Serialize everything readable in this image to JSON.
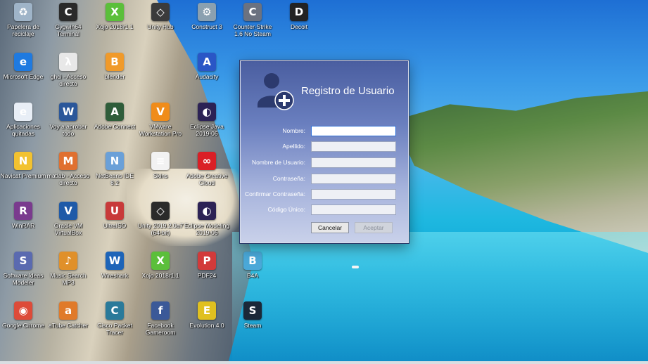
{
  "desktop": {
    "icons": [
      {
        "label": "Papelera de reciclaje",
        "icon": "recycle-bin-icon",
        "color": "#9fb4c8",
        "glyph": "♻"
      },
      {
        "label": "Cygwin64 Terminal",
        "icon": "terminal-icon",
        "color": "#2a2a2a",
        "glyph": "C"
      },
      {
        "label": "Xojo 2018r1.1",
        "icon": "xojo-icon",
        "color": "#5bbf3a",
        "glyph": "X"
      },
      {
        "label": "Unity Hub",
        "icon": "unity-icon",
        "color": "#3b3b3b",
        "glyph": "◇"
      },
      {
        "label": "Construct 3",
        "icon": "construct-icon",
        "color": "#8aa0b0",
        "glyph": "⚙"
      },
      {
        "label": "Counter-Strike 1.6 No Steam",
        "icon": "counter-strike-icon",
        "color": "#6b7280",
        "glyph": "C"
      },
      {
        "label": "Decoit",
        "icon": "decoit-icon",
        "color": "#222222",
        "glyph": "D"
      },
      {
        "label": "Microsoft Edge",
        "icon": "edge-icon",
        "color": "#1f7ae0",
        "glyph": "e"
      },
      {
        "label": "ghci - Acceso directo",
        "icon": "ghci-icon",
        "color": "#e8e8e8",
        "glyph": "λ"
      },
      {
        "label": "blender",
        "icon": "blender-icon",
        "color": "#f09a2a",
        "glyph": "B"
      },
      {
        "label": "Audacity",
        "icon": "audacity-icon",
        "color": "#2a56c6",
        "glyph": "A"
      },
      {
        "label": "Aplicaciones quitadas",
        "icon": "html-document-icon",
        "color": "#e8eef6",
        "glyph": "e"
      },
      {
        "label": "Voy a aprobar todo",
        "icon": "word-icon",
        "color": "#2b579a",
        "glyph": "W"
      },
      {
        "label": "Adobe Connect",
        "icon": "adobe-connect-icon",
        "color": "#2f5d3a",
        "glyph": "A"
      },
      {
        "label": "VMware Workstation Pro",
        "icon": "vmware-icon",
        "color": "#f08c1a",
        "glyph": "V"
      },
      {
        "label": "Eclipse Java 2019-06",
        "icon": "eclipse-icon",
        "color": "#2c2255",
        "glyph": "◐"
      },
      {
        "label": "Navicat Premium",
        "icon": "navicat-icon",
        "color": "#f2c230",
        "glyph": "N"
      },
      {
        "label": "matlab - Acceso directo",
        "icon": "matlab-icon",
        "color": "#e07030",
        "glyph": "M"
      },
      {
        "label": "NetBeans IDE 8.2",
        "icon": "netbeans-icon",
        "color": "#6aa0d8",
        "glyph": "N"
      },
      {
        "label": "Skins",
        "icon": "text-file-icon",
        "color": "#f2f2f2",
        "glyph": "≡"
      },
      {
        "label": "Adobe Creative Cloud",
        "icon": "creative-cloud-icon",
        "color": "#da1f26",
        "glyph": "∞"
      },
      {
        "label": "WinRAR",
        "icon": "winrar-icon",
        "color": "#7a3a8e",
        "glyph": "R"
      },
      {
        "label": "Oracle VM VirtualBox",
        "icon": "virtualbox-icon",
        "color": "#1e5aa8",
        "glyph": "V"
      },
      {
        "label": "UltraISO",
        "icon": "ultraiso-icon",
        "color": "#c83a3a",
        "glyph": "U"
      },
      {
        "label": "Unity 2019.2.0a7 (64-bit)",
        "icon": "unity-icon",
        "color": "#2a2a2a",
        "glyph": "◇"
      },
      {
        "label": "Eclipse Modeling 2019-06",
        "icon": "eclipse-modeling-icon",
        "color": "#2c2255",
        "glyph": "◐"
      },
      {
        "label": "Software Ideas Modeler",
        "icon": "modeler-icon",
        "color": "#5a6ab0",
        "glyph": "S"
      },
      {
        "label": "Music Search MP3",
        "icon": "music-search-icon",
        "color": "#e0902a",
        "glyph": "♪"
      },
      {
        "label": "Wireshark",
        "icon": "wireshark-icon",
        "color": "#1d64b8",
        "glyph": "W"
      },
      {
        "label": "Xojo 2018r1.1",
        "icon": "xojo-icon",
        "color": "#5bbf3a",
        "glyph": "X"
      },
      {
        "label": "PDF24",
        "icon": "pdf24-icon",
        "color": "#d23a3a",
        "glyph": "P"
      },
      {
        "label": "B4A",
        "icon": "b4a-icon",
        "color": "#4aa8d8",
        "glyph": "B"
      },
      {
        "label": "Google Chrome",
        "icon": "chrome-icon",
        "color": "#dd4b39",
        "glyph": "◉"
      },
      {
        "label": "aTube Catcher",
        "icon": "atube-catcher-icon",
        "color": "#e07a2a",
        "glyph": "a"
      },
      {
        "label": "Cisco Packet Tracer",
        "icon": "packet-tracer-icon",
        "color": "#2a7a9a",
        "glyph": "C"
      },
      {
        "label": "Facebook Gameroom",
        "icon": "gameroom-icon",
        "color": "#3b5998",
        "glyph": "f"
      },
      {
        "label": "Evolution 4.0",
        "icon": "evolution-icon",
        "color": "#e0c020",
        "glyph": "E"
      },
      {
        "label": "Steam",
        "icon": "steam-icon",
        "color": "#1b2838",
        "glyph": "S"
      }
    ]
  },
  "dialog": {
    "title": "Registro de Usuario",
    "fields": [
      {
        "label": "Nombre:",
        "value": ""
      },
      {
        "label": "Apellido:",
        "value": ""
      },
      {
        "label": "Nombre de Usuario:",
        "value": ""
      },
      {
        "label": "Contraseña:",
        "value": ""
      },
      {
        "label": "Confirmar Contraseña:",
        "value": ""
      },
      {
        "label": "Código Único:",
        "value": ""
      }
    ],
    "cancel_label": "Cancelar",
    "accept_label": "Aceptar"
  }
}
